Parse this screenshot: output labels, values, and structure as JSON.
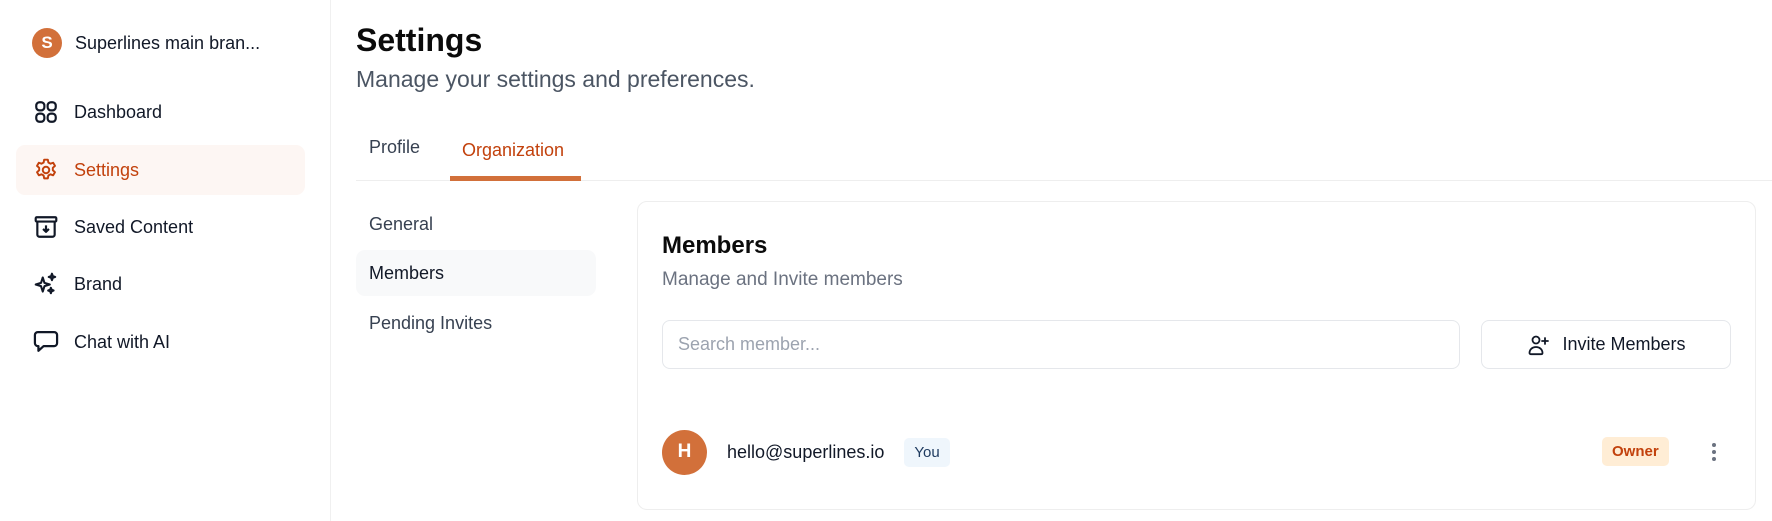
{
  "sidebar": {
    "org": {
      "initial": "S",
      "name": "Superlines main bran..."
    },
    "items": [
      {
        "label": "Dashboard",
        "icon": "dashboard-grid-icon",
        "active": false
      },
      {
        "label": "Settings",
        "icon": "gear-icon",
        "active": true
      },
      {
        "label": "Saved Content",
        "icon": "archive-download-icon",
        "active": false
      },
      {
        "label": "Brand",
        "icon": "sparkles-icon",
        "active": false
      },
      {
        "label": "Chat with AI",
        "icon": "chat-bubble-icon",
        "active": false
      }
    ]
  },
  "header": {
    "title": "Settings",
    "subtitle": "Manage your settings and preferences."
  },
  "tabs": [
    {
      "label": "Profile",
      "active": false
    },
    {
      "label": "Organization",
      "active": true
    }
  ],
  "subnav": [
    {
      "label": "General",
      "active": false
    },
    {
      "label": "Members",
      "active": true
    },
    {
      "label": "Pending Invites",
      "active": false
    }
  ],
  "members_card": {
    "title": "Members",
    "subtitle": "Manage and Invite members",
    "search": {
      "placeholder": "Search member...",
      "value": ""
    },
    "invite_button": {
      "label": "Invite Members",
      "icon": "user-plus-icon"
    },
    "members": [
      {
        "initial": "H",
        "email": "hello@superlines.io",
        "you_badge": "You",
        "role": "Owner"
      }
    ]
  },
  "colors": {
    "accent": "#d2703a",
    "accent_text": "#c2410c",
    "active_bg": "#fdf6f3",
    "owner_badge_bg": "#ffedd5",
    "you_badge_bg": "#eff6fc"
  }
}
